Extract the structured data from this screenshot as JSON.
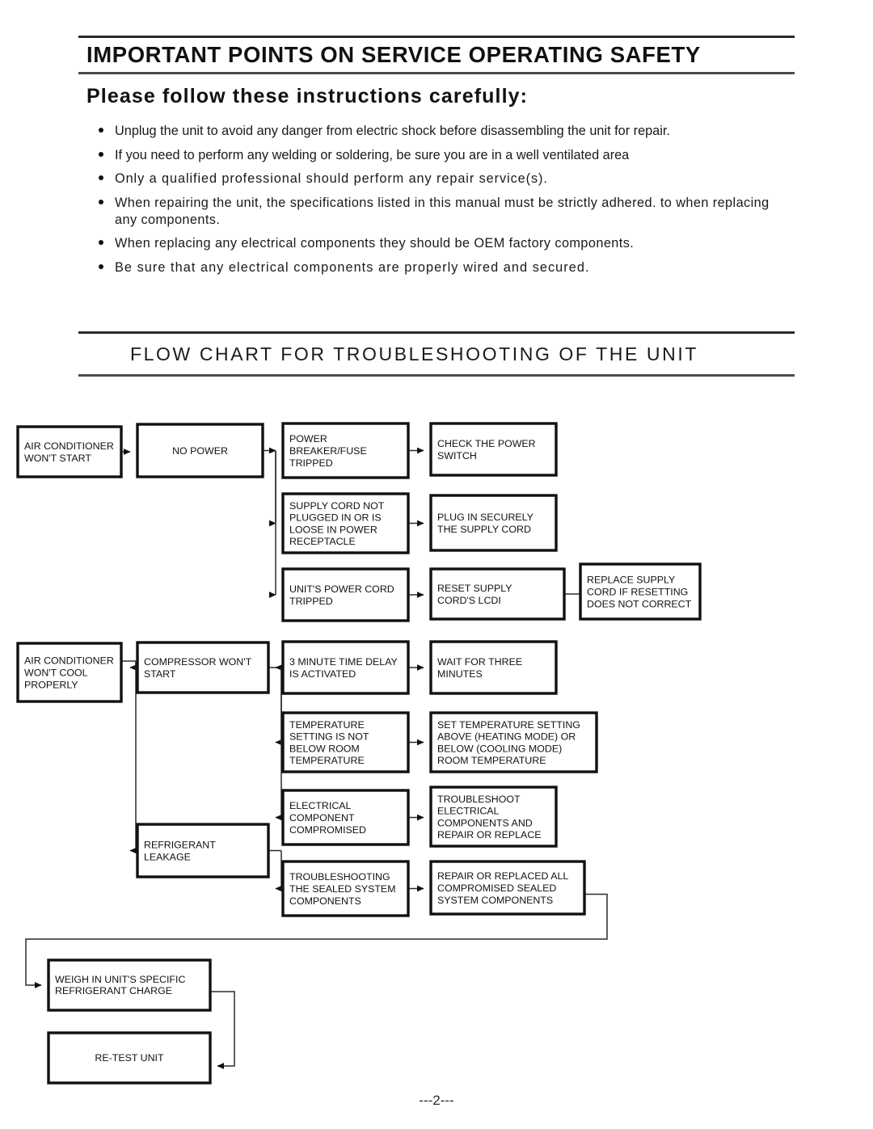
{
  "section1": {
    "title": "IMPORTANT POINTS ON SERVICE OPERATING SAFETY",
    "subtitle": "Please follow these instructions carefully:",
    "bullets": [
      "Unplug the unit to avoid any danger from electric shock before disassembling the unit for repair.",
      "If you need to perform any welding or soldering, be sure you are in a well ventilated area",
      "Only a qualified professional should perform any repair service(s).",
      "When repairing the unit, the specifications listed in this manual must be strictly adhered. to when replacing any components.",
      "When replacing any electrical components they should be OEM factory components.",
      "Be sure that any electrical components are properly wired and secured."
    ]
  },
  "section2": {
    "title": "FLOW CHART FOR TROUBLESHOOTING OF THE UNIT"
  },
  "flowchart": {
    "type": "diagram",
    "nodes": {
      "ac_wont_start": "AIR CONDITIONER\nWON'T START",
      "no_power": "NO POWER",
      "breaker_tripped": "POWER\nBREAKER/FUSE\nTRIPPED",
      "check_switch": "CHECK THE POWER\nSWITCH",
      "cord_not_plugged": "SUPPLY CORD NOT\nPLUGGED IN OR IS\nLOOSE IN POWER\nRECEPTACLE",
      "plug_securely": "PLUG IN SECURELY\nTHE SUPPLY CORD",
      "cord_tripped": "UNIT'S POWER CORD\nTRIPPED",
      "reset_lcdi": "RESET SUPPLY\nCORD'S LCDI",
      "replace_cord": "REPLACE SUPPLY\nCORD IF RESETTING\nDOES NOT CORRECT",
      "ac_wont_cool": "AIR CONDITIONER\nWON'T COOL\nPROPERLY",
      "compressor_wont_start": "COMPRESSOR WON'T\nSTART",
      "time_delay": "3 MINUTE TIME DELAY\nIS ACTIVATED",
      "wait_three": "WAIT FOR THREE\nMINUTES",
      "temp_setting": "TEMPERATURE\nSETTING IS NOT\nBELOW ROOM\nTEMPERATURE",
      "set_temp": "SET TEMPERATURE SETTING\nABOVE (HEATING MODE) OR\nBELOW (COOLING MODE)\nROOM TEMPERATURE",
      "elec_compromised": "ELECTRICAL\nCOMPONENT\nCOMPROMISED",
      "troubleshoot_elec": "TROUBLESHOOT\nELECTRICAL\nCOMPONENTS AND\nREPAIR OR REPLACE",
      "refrigerant_leakage": "REFRIGERANT\nLEAKAGE",
      "troubleshoot_sealed": "TROUBLESHOOTING\nTHE SEALED SYSTEM\nCOMPONENTS",
      "repair_sealed": "REPAIR OR REPLACED ALL\nCOMPROMISED SEALED\nSYSTEM COMPONENTS",
      "weigh_charge": "WEIGH IN UNIT'S SPECIFIC\nREFRIGERANT CHARGE",
      "retest": "RE-TEST UNIT"
    }
  },
  "footer": {
    "page": "---2---"
  }
}
